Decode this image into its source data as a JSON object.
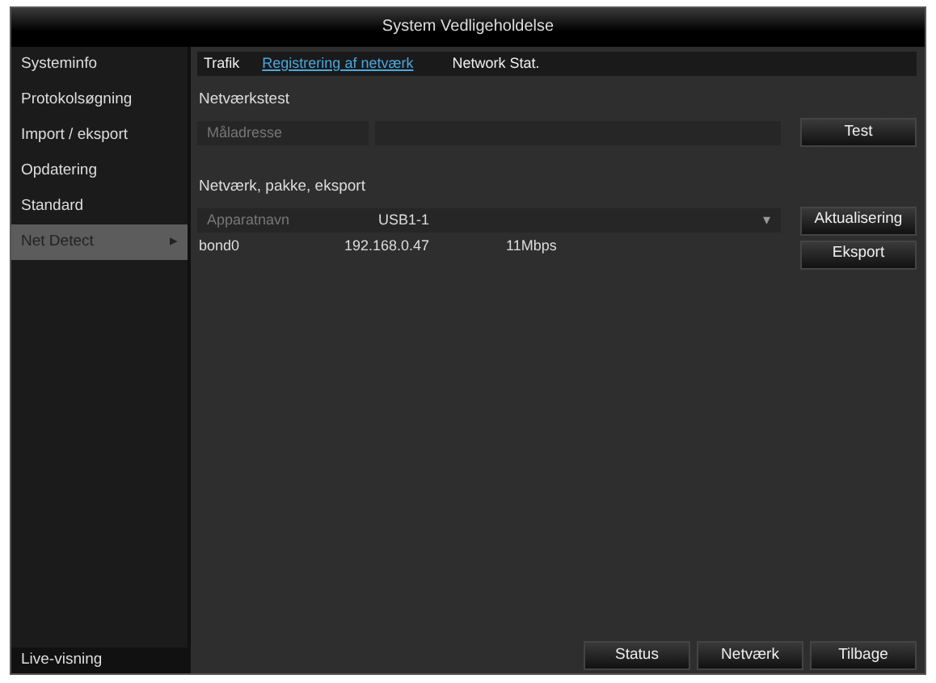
{
  "window": {
    "title": "System Vedligeholdelse"
  },
  "sidebar": {
    "items": [
      {
        "label": "Systeminfo",
        "selected": false
      },
      {
        "label": "Protokolsøgning",
        "selected": false
      },
      {
        "label": "Import / eksport",
        "selected": false
      },
      {
        "label": "Opdatering",
        "selected": false
      },
      {
        "label": "Standard",
        "selected": false
      },
      {
        "label": "Net Detect",
        "selected": true,
        "arrow": "▸"
      }
    ],
    "footer": "Live-visning"
  },
  "tabs": [
    {
      "label": "Trafik",
      "selected": false
    },
    {
      "label": "Registrering af netværk",
      "selected": true
    },
    {
      "label": "Network Stat.",
      "selected": false
    }
  ],
  "network_test": {
    "title": "Netværkstest",
    "address_label": "Måladresse",
    "button": "Test"
  },
  "export": {
    "title": "Netværk, pakke, eksport",
    "device_label": "Apparatnavn",
    "device_value": "USB1-1",
    "caret": "▾",
    "buttons": [
      "Aktualisering",
      "Eksport"
    ],
    "rows": [
      [
        "bond0",
        "192.168.0.47",
        "11Mbps"
      ]
    ]
  },
  "bottom_buttons": [
    "Status",
    "Netværk",
    "Tilbage"
  ]
}
